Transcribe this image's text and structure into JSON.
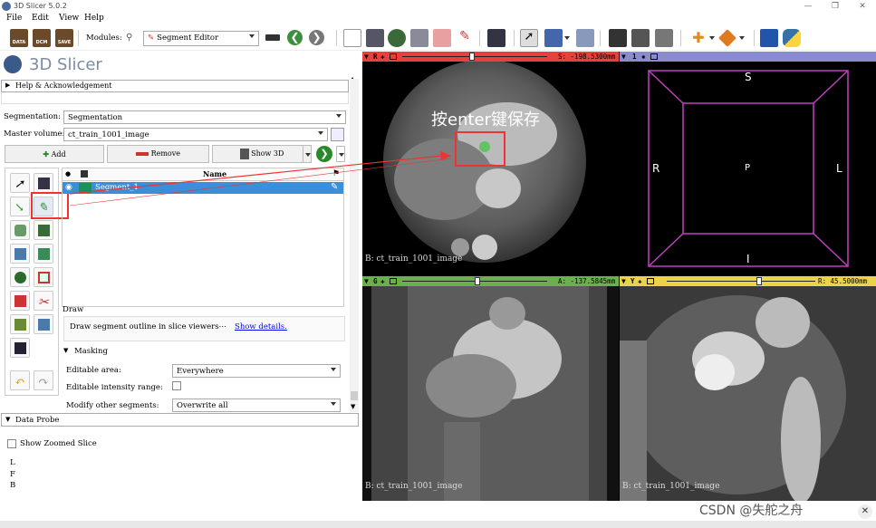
{
  "app": {
    "title": "3D Slicer 5.0.2",
    "logo_text": "3D Slicer"
  },
  "menu": [
    "File",
    "Edit",
    "View",
    "Help"
  ],
  "toolbar": {
    "data_label": "DATA",
    "dcm_label": "DCM",
    "save_label": "SAVE",
    "modules_label": "Modules:",
    "module_value": "Segment Editor"
  },
  "help_section": "Help & Acknowledgement",
  "segmentation": {
    "label": "Segmentation:",
    "value": "Segmentation"
  },
  "master_volume": {
    "label": "Master volume:",
    "value": "ct_train_1001_image"
  },
  "buttons": {
    "add": "Add",
    "remove": "Remove",
    "show3d": "Show 3D"
  },
  "table": {
    "header_name": "Name",
    "rows": [
      {
        "name": "Segment_1",
        "color": "#1e8f5a"
      }
    ]
  },
  "effect": {
    "title": "Draw",
    "description": "Draw segment outline in slice viewers⋯",
    "show_details": "Show details."
  },
  "masking": {
    "title": "Masking",
    "editable_area_label": "Editable area:",
    "editable_area_value": "Everywhere",
    "intensity_label": "Editable intensity range:",
    "modify_label": "Modify other segments:",
    "modify_value": "Overwrite all"
  },
  "data_probe": {
    "title": "Data Probe",
    "show_zoomed": "Show Zoomed Slice",
    "coords": [
      "L",
      "F",
      "B"
    ]
  },
  "views": {
    "red": {
      "letter": "R",
      "value": "S: -198.5300mm",
      "footer": "B: ct_train_1001_image",
      "color": "#e8403a",
      "slider_pct": 0.48
    },
    "green": {
      "letter": "G",
      "value": "A: -137.5845mm",
      "footer": "B: ct_train_1001_image",
      "color": "#6ab04c",
      "slider_pct": 0.52
    },
    "yellow": {
      "letter": "Y",
      "value": "R: 45.5000mm",
      "footer": "B: ct_train_1001_image",
      "color": "#ecd34a",
      "slider_pct": 0.62
    },
    "threed": {
      "letter": "1",
      "color": "#8b8bd0",
      "labels": {
        "top": "S",
        "left": "R",
        "center": "P",
        "right": "L",
        "bottom": "I"
      }
    }
  },
  "annotation": {
    "text": "按enter键保存"
  },
  "watermark": "CSDN @失舵之舟"
}
